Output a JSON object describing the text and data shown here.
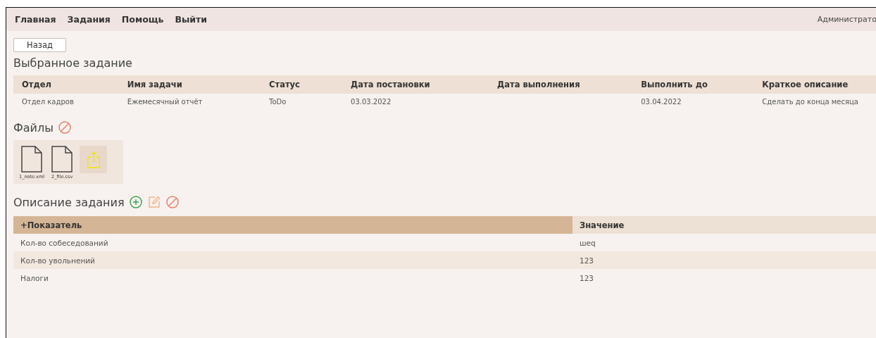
{
  "nav": {
    "items": [
      "Главная",
      "Задания",
      "Помощь",
      "Выйти"
    ],
    "user": "Администрато"
  },
  "back_button": "Назад",
  "task_title": "Выбранное задание",
  "task_table": {
    "columns": [
      "Отдел",
      "Имя задачи",
      "Статус",
      "Дата постановки",
      "Дата выполнения",
      "Выполнить до",
      "Краткое описание"
    ],
    "rows": [
      [
        "Отдел кадров",
        "Ежемесячный отчёт",
        "ToDo",
        "03.03.2022",
        "",
        "03.04.2022",
        "Сделать до конца месяца"
      ]
    ]
  },
  "files_title": "Файлы",
  "files": [
    {
      "kind": "file",
      "name": "1_note.xml"
    },
    {
      "kind": "file",
      "name": "2_file.csv"
    },
    {
      "kind": "upload"
    }
  ],
  "description_title": "Описание задания",
  "description_table": {
    "columns": [
      {
        "label": "+Показатель",
        "sorted": true
      },
      {
        "label": "Значение",
        "sorted": false
      }
    ],
    "rows": [
      [
        "Кол-во собеседований",
        "шеq"
      ],
      [
        "Кол-во увольнений",
        "123"
      ],
      [
        "Налоги",
        "123"
      ]
    ]
  }
}
